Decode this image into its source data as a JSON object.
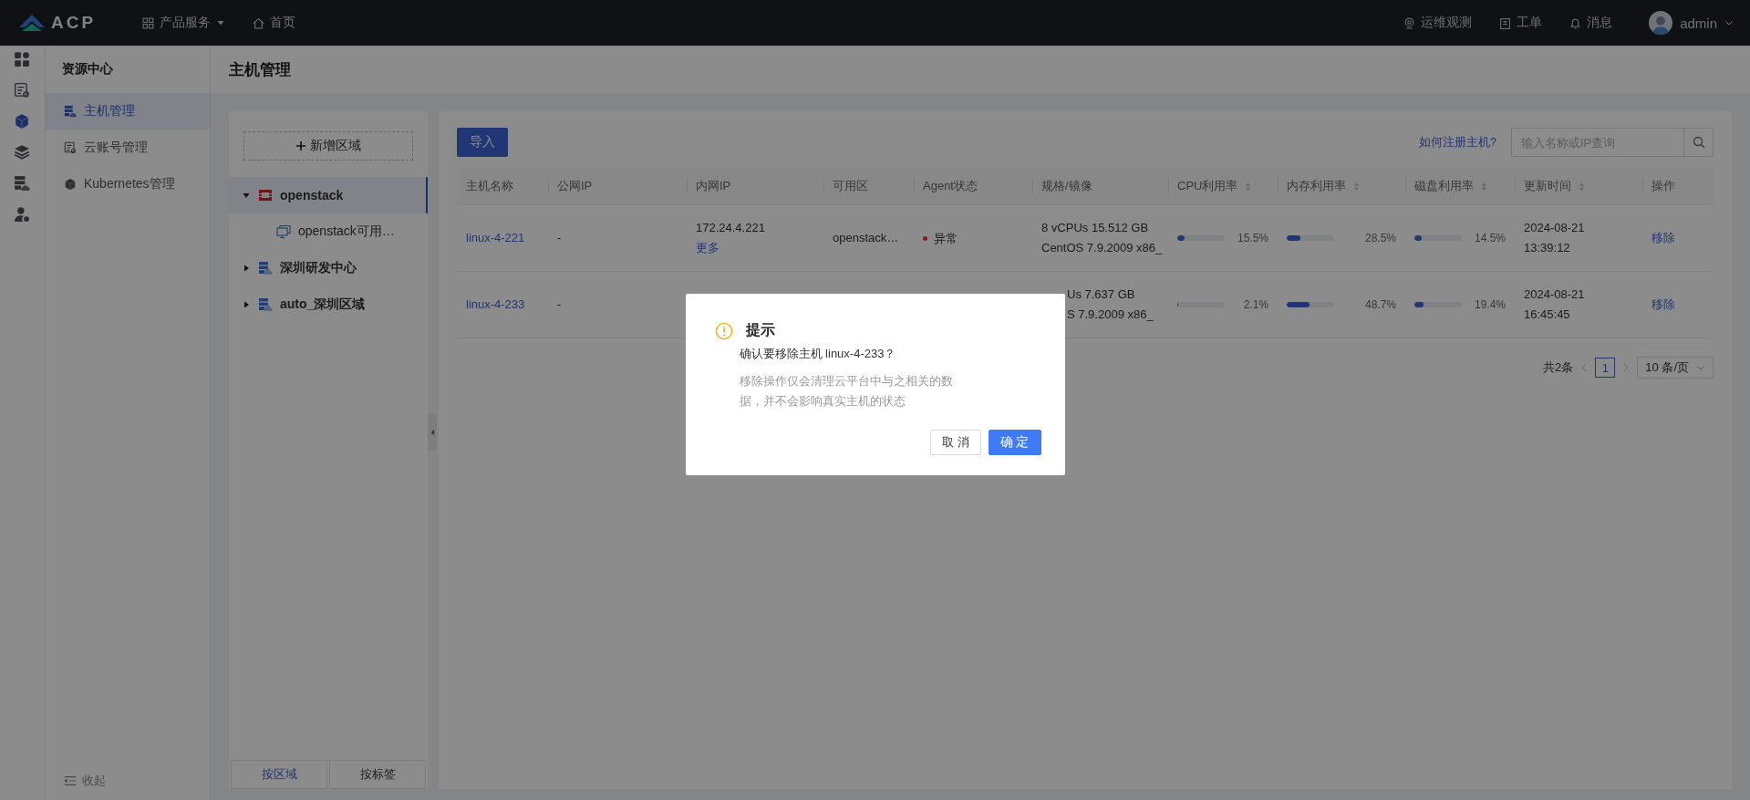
{
  "topbar": {
    "logo": "ACP",
    "menu": [
      {
        "label": "产品服务",
        "kind": "dropdown"
      },
      {
        "label": "首页",
        "kind": "home"
      }
    ],
    "right": [
      {
        "label": "运维观测",
        "kind": "observe"
      },
      {
        "label": "工单",
        "kind": "ticket"
      },
      {
        "label": "消息",
        "kind": "bell"
      }
    ],
    "user": "admin"
  },
  "rail": [
    {
      "kind": "dashboard",
      "selected": false
    },
    {
      "kind": "settings-list",
      "selected": false
    },
    {
      "kind": "cube",
      "selected": true
    },
    {
      "kind": "layers",
      "selected": false
    },
    {
      "kind": "server",
      "selected": false
    },
    {
      "kind": "user",
      "selected": false
    }
  ],
  "sidebar": {
    "title": "资源中心",
    "items": [
      {
        "label": "主机管理",
        "kind": "server",
        "selected": true
      },
      {
        "label": "云账号管理",
        "kind": "settings-list",
        "selected": false
      },
      {
        "label": "Kubernetes管理",
        "kind": "cube",
        "selected": false
      }
    ],
    "collapse": "收起"
  },
  "page_title": "主机管理",
  "tree_panel": {
    "add_button": "新增区域",
    "nodes": [
      {
        "label": "openstack",
        "kind": "openstack",
        "selected": true,
        "expanded": true,
        "children": [
          {
            "label": "openstack可用…",
            "kind": "zone",
            "selected": false
          }
        ]
      },
      {
        "label": "深圳研发中心",
        "kind": "region",
        "selected": false,
        "expanded": false
      },
      {
        "label": "auto_深圳区域",
        "kind": "region",
        "selected": false,
        "expanded": false
      }
    ],
    "tabs": [
      {
        "label": "按区域",
        "selected": true
      },
      {
        "label": "按标签",
        "selected": false
      }
    ]
  },
  "toolbar": {
    "import_button": "导入",
    "help_link": "如何注册主机?",
    "search": {
      "placeholder": "输入名称或IP查询"
    }
  },
  "table": {
    "columns": [
      {
        "label": "主机名称",
        "sortable": false
      },
      {
        "label": "公网IP",
        "sortable": false
      },
      {
        "label": "内网IP",
        "sortable": false
      },
      {
        "label": "可用区",
        "sortable": false
      },
      {
        "label": "Agent状态",
        "sortable": false
      },
      {
        "label": "规格/镜像",
        "sortable": false
      },
      {
        "label": "CPU利用率",
        "sortable": true
      },
      {
        "label": "内存利用率",
        "sortable": true
      },
      {
        "label": "磁盘利用率",
        "sortable": true
      },
      {
        "label": "更新时间",
        "sortable": true
      },
      {
        "label": "操作",
        "sortable": false
      }
    ],
    "rows": [
      {
        "name": "linux-4-221",
        "public_ip": "-",
        "private_ip": "172.24.4.221",
        "more": "更多",
        "zone": "openstack…",
        "agent": {
          "label": "异常",
          "kind": "error"
        },
        "covered": false,
        "spec": [
          "8 vCPUs 15.512 GB",
          "CentOS 7.9.2009 x86_"
        ],
        "cpu": {
          "level": 0.155,
          "reading": "15.5%"
        },
        "memory": {
          "level": 0.285,
          "reading": "28.5%"
        },
        "disk": {
          "level": 0.145,
          "reading": "14.5%"
        },
        "updated": [
          "2024-08-21",
          "13:39:12"
        ],
        "action": "移除"
      },
      {
        "name": "linux-4-233",
        "public_ip": "-",
        "covered": true,
        "spec": [
          "Us 7.637 GB",
          "S 7.9.2009 x86_"
        ],
        "cpu": {
          "level": 0.021,
          "reading": "2.1%"
        },
        "memory": {
          "level": 0.487,
          "reading": "48.7%"
        },
        "disk": {
          "level": 0.194,
          "reading": "19.4%"
        },
        "updated": [
          "2024-08-21",
          "16:45:45"
        ],
        "action": "移除"
      }
    ]
  },
  "pagination": {
    "total": "共2条",
    "pages": [
      {
        "label": "1",
        "selected": true
      }
    ],
    "page_size": "10 条/页"
  },
  "dialog": {
    "title": "提示",
    "message": "确认要移除主机 linux-4-233？",
    "detail": "移除操作仅会清理云平台中与之相关的数据，并不会影响真实主机的状态",
    "buttons": [
      {
        "label": "取 消",
        "kind": "default"
      },
      {
        "label": "确 定",
        "kind": "primary"
      }
    ]
  }
}
